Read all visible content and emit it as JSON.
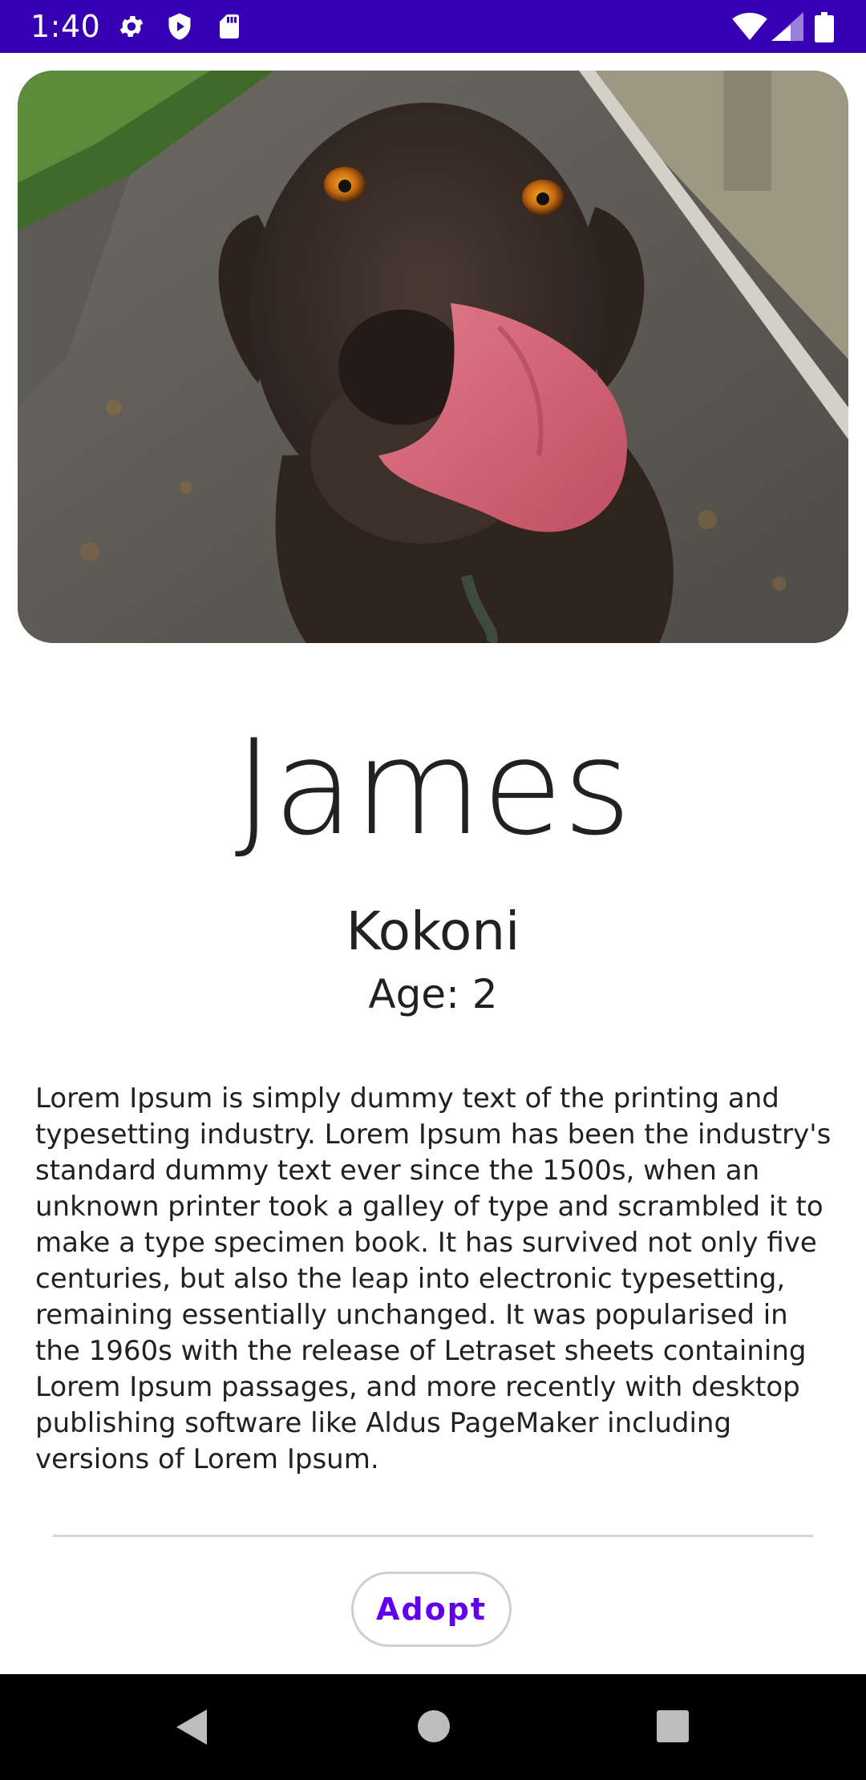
{
  "status_bar": {
    "time": "1:40",
    "icons_left": [
      "gear-icon",
      "shield-play-icon",
      "sd-card-icon"
    ],
    "icons_right": [
      "wifi-icon",
      "signal-icon",
      "battery-icon"
    ],
    "background": "#3700b3"
  },
  "pet": {
    "photo_icon": "dog-photo",
    "name": "James",
    "breed": "Kokoni",
    "age": "Age: 2",
    "description": "Lorem Ipsum is simply dummy text of the printing and typesetting industry. Lorem Ipsum has been the industry's standard dummy text ever since the 1500s, when an unknown printer took a galley of type and scrambled it to make a type specimen book. It has survived not only five centuries, but also the leap into electronic typesetting, remaining essentially unchanged. It was popularised in the 1960s with the release of Letraset sheets containing Lorem Ipsum passages, and more recently with desktop publishing software like Aldus PageMaker including versions of Lorem Ipsum."
  },
  "actions": {
    "adopt_label": "Adopt",
    "accent": "#6200ee"
  },
  "nav_bar": {
    "items": [
      "back-icon",
      "home-icon",
      "recents-icon"
    ]
  }
}
